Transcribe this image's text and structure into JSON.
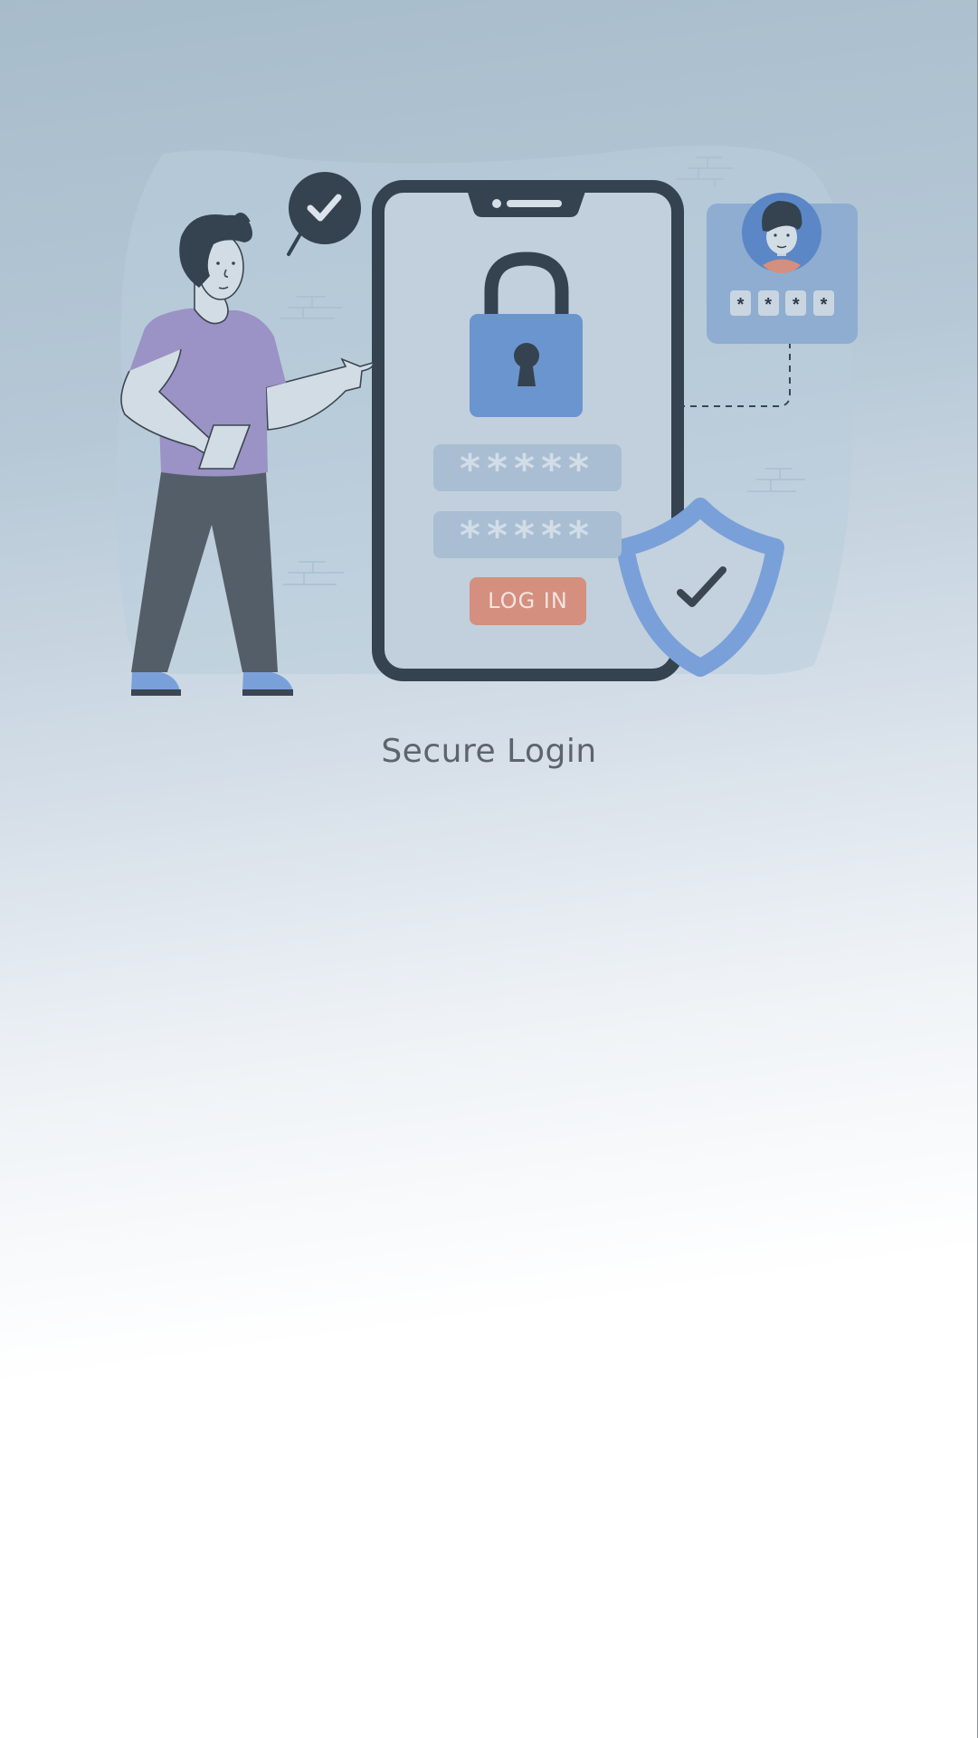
{
  "screen": {
    "title": "Secure Login"
  },
  "illustration": {
    "password_field_1": "*****",
    "password_field_2": "*****",
    "login_button_label": "LOG IN",
    "pin_digits": [
      "*",
      "*",
      "*",
      "*"
    ]
  },
  "colors": {
    "phone_frame": "#34434f",
    "lock_body": "#6b95cf",
    "shield": "#7aa0da",
    "login_button": "#d48f7e",
    "shirt": "#9b92c6",
    "pants": "#545e68",
    "profile_card": "#8fadd1"
  }
}
